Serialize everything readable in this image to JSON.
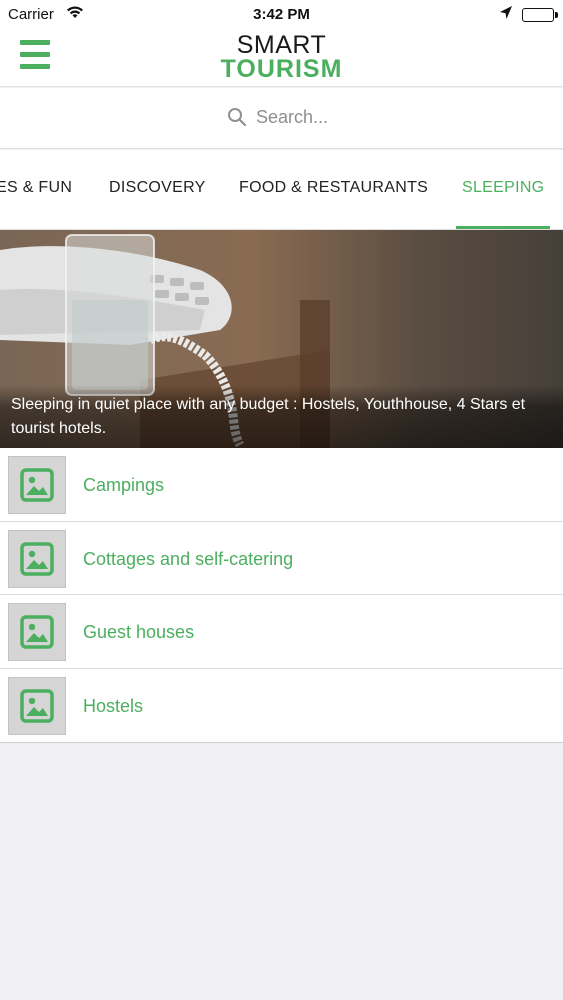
{
  "status_bar": {
    "carrier": "Carrier",
    "time": "3:42 PM"
  },
  "header": {
    "logo_top": "SMART",
    "logo_bottom": "TOURISM",
    "accent_color": "#4caf5f"
  },
  "search": {
    "placeholder": "Search..."
  },
  "tabs": [
    {
      "label": "ES & FUN",
      "active": false
    },
    {
      "label": "DISCOVERY",
      "active": false
    },
    {
      "label": "FOOD & RESTAURANTS",
      "active": false
    },
    {
      "label": "SLEEPING",
      "active": true
    }
  ],
  "hero": {
    "caption": "Sleeping in quiet place with any budget : Hostels, Youthhouse, 4 Stars et tourist hotels."
  },
  "categories": [
    {
      "label": "Campings",
      "icon": "image-placeholder-icon"
    },
    {
      "label": "Cottages and self-catering",
      "icon": "image-placeholder-icon"
    },
    {
      "label": "Guest houses",
      "icon": "image-placeholder-icon"
    },
    {
      "label": "Hostels",
      "icon": "image-placeholder-icon"
    }
  ]
}
